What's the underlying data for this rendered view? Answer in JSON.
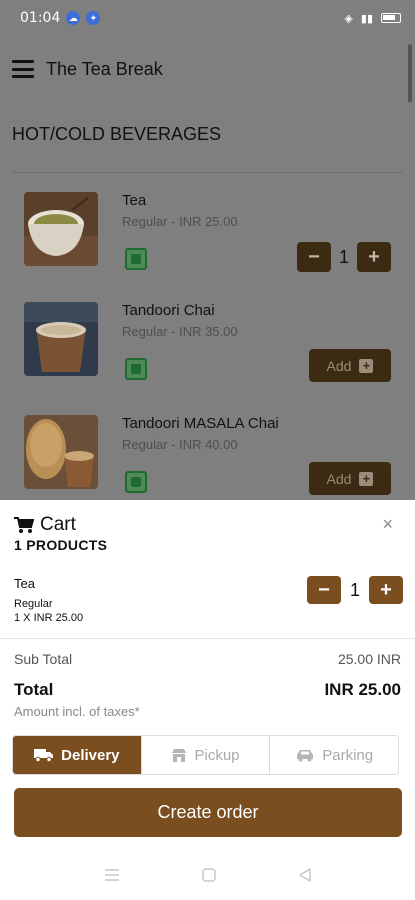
{
  "status_bar": {
    "time": "01:04"
  },
  "app_bar": {
    "title": "The Tea Break"
  },
  "menu": {
    "category": "HOT/COLD BEVERAGES",
    "items": [
      {
        "name": "Tea",
        "price": "Regular - INR 25.00",
        "quantity": "1"
      },
      {
        "name": "Tandoori Chai",
        "price": "Regular - INR 35.00",
        "add_label": "Add"
      },
      {
        "name": "Tandoori MASALA Chai",
        "price": "Regular - INR 40.00",
        "add_label": "Add"
      }
    ]
  },
  "cart": {
    "title": "Cart",
    "count": "1 PRODUCTS",
    "close": "×",
    "line": {
      "name": "Tea",
      "variant": "Regular",
      "qty_price": "1 X INR 25.00",
      "quantity": "1"
    },
    "subtotal_label": "Sub Total",
    "subtotal_value": "25.00 INR",
    "total_label": "Total",
    "total_value": "INR 25.00",
    "tax_note": "Amount incl. of taxes*",
    "tabs": [
      {
        "label": "Delivery",
        "active": true
      },
      {
        "label": "Pickup",
        "active": false
      },
      {
        "label": "Parking",
        "active": false
      }
    ],
    "create_label": "Create order"
  },
  "colors": {
    "accent": "#7a4e1e",
    "veg": "#1e6a30",
    "overlay": "#7f7f7f"
  }
}
